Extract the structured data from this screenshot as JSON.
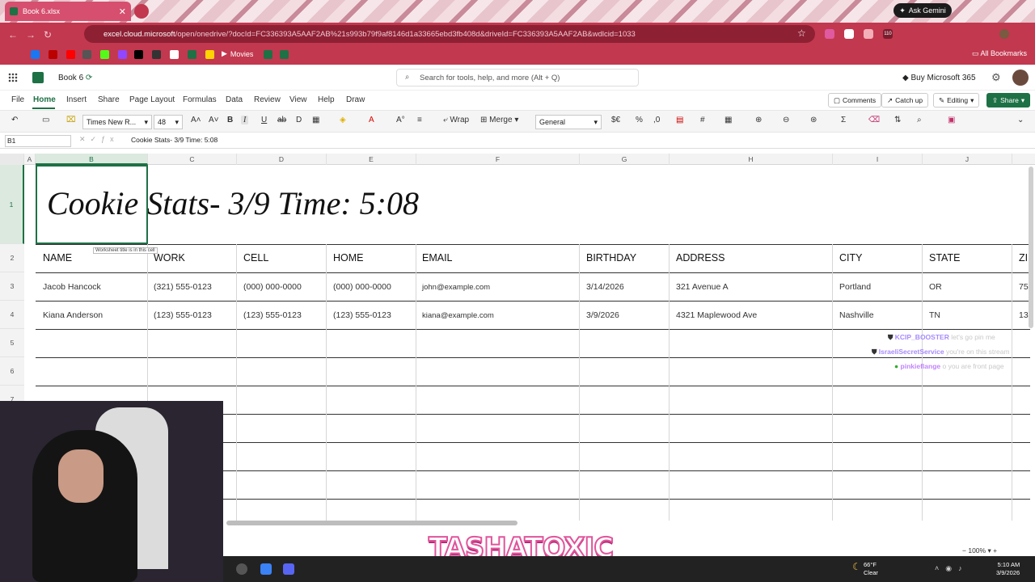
{
  "browser": {
    "tab_title": "Book 6.xlsx",
    "tab_close": "✕",
    "ask_gemini": "Ask Gemini",
    "url_host": "excel.cloud.microsoft",
    "url_path": "/open/onedrive/?docId=FC336393A5AAF2AB%21s993b79f9af8146d1a33665ebd3fb408d&driveId=FC336393A5AAF2AB&wdlcid=1033",
    "bookmark_movies": "Movies",
    "all_bookmarks": "All Bookmarks",
    "ext_badge": "110"
  },
  "excel": {
    "book_name": "Book 6",
    "search_placeholder": "Search for tools, help, and more (Alt + Q)",
    "buy_label": "Buy Microsoft 365",
    "menu": [
      "File",
      "Home",
      "Insert",
      "Share",
      "Page Layout",
      "Formulas",
      "Data",
      "Review",
      "View",
      "Help",
      "Draw"
    ],
    "comments_label": "Comments",
    "catchup_label": "Catch up",
    "editing_label": "Editing",
    "share_label": "Share",
    "font_name": "Times New R...",
    "font_size": "48",
    "wrap_label": "Wrap",
    "merge_label": "Merge",
    "number_format": "General",
    "name_box": "B1",
    "formula_value": "Cookie Stats- 3/9 Time: 5:08",
    "tooltip": "Worksheet title is in this cell",
    "zoom": "100%"
  },
  "sheet": {
    "columns": [
      "A",
      "B",
      "C",
      "D",
      "E",
      "F",
      "G",
      "H",
      "I",
      "J"
    ],
    "rows": [
      "1",
      "2",
      "3",
      "4",
      "5",
      "6",
      "7"
    ],
    "title": "Cookie Stats- 3/9 Time: 5:08",
    "headers": [
      "NAME",
      "WORK",
      "CELL",
      "HOME",
      "EMAIL",
      "BIRTHDAY",
      "ADDRESS",
      "CITY",
      "STATE",
      "ZI"
    ],
    "data": [
      [
        "Jacob Hancock",
        "(321) 555-0123",
        "(000) 000-0000",
        "(000) 000-0000",
        "john@example.com",
        "3/14/2026",
        "321 Avenue A",
        "Portland",
        "OR",
        "75"
      ],
      [
        "Kiana Anderson",
        "(123) 555-0123",
        "(123) 555-0123",
        "(123) 555-0123",
        "kiana@example.com",
        "3/9/2026",
        "4321 Maplewood Ave",
        "Nashville",
        "TN",
        "13"
      ]
    ]
  },
  "chat": [
    {
      "user": "KCIP_BOOSTER",
      "text": "let's go pin me",
      "color": "#a78bfa"
    },
    {
      "user": "IsraeliSecretService",
      "text": "you're on this stream",
      "color": "#a78bfa"
    },
    {
      "user": "pinkieflange",
      "text": "o you are front page",
      "color": "#c084fc"
    }
  ],
  "overlay": {
    "brand": "TASHATOXIC"
  },
  "taskbar": {
    "temp": "66°F",
    "condition": "Clear",
    "time": "5:10 AM",
    "date": "3/9/2026"
  }
}
